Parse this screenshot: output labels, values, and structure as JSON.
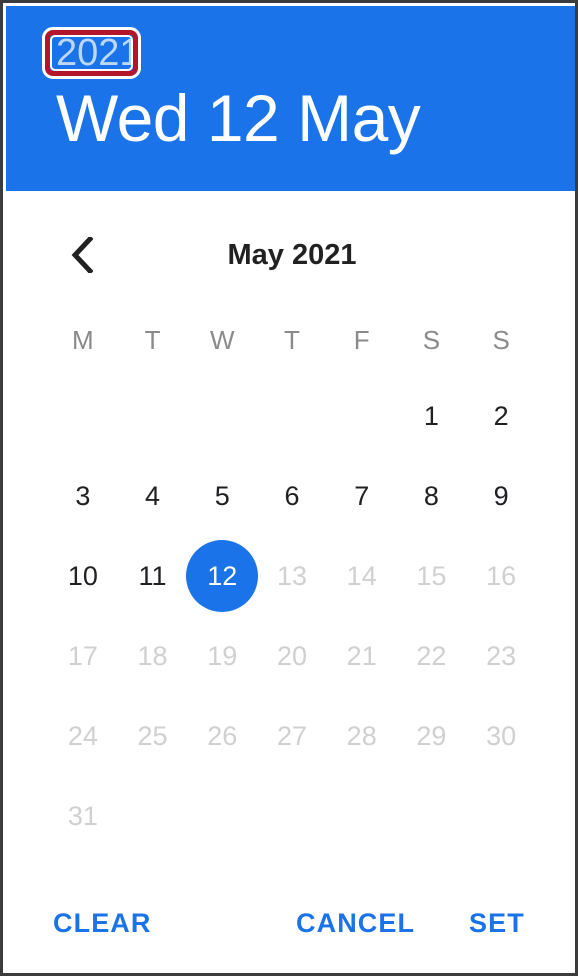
{
  "dialog": {
    "name": "material-date-picker",
    "header": {
      "year": "2021",
      "selected_date_label": "Wed 12 May",
      "background_color": "#1a73e8",
      "year_color": "#bcd7f7",
      "date_color": "#ffffff"
    },
    "annotation": {
      "target": "year",
      "shape": "rounded-rectangle",
      "color": "#b3162a"
    },
    "calendar": {
      "month_label": "May 2021",
      "prev_icon": "chevron-left-icon",
      "weekdays": [
        "M",
        "T",
        "W",
        "T",
        "F",
        "S",
        "S"
      ],
      "selected_day": "12",
      "selection_color": "#1a73e8",
      "disabled_color": "#d0d0d0",
      "weeks": [
        [
          {
            "label": "",
            "state": "empty"
          },
          {
            "label": "",
            "state": "empty"
          },
          {
            "label": "",
            "state": "empty"
          },
          {
            "label": "",
            "state": "empty"
          },
          {
            "label": "",
            "state": "empty"
          },
          {
            "label": "1",
            "state": "enabled"
          },
          {
            "label": "2",
            "state": "enabled"
          }
        ],
        [
          {
            "label": "3",
            "state": "enabled"
          },
          {
            "label": "4",
            "state": "enabled"
          },
          {
            "label": "5",
            "state": "enabled"
          },
          {
            "label": "6",
            "state": "enabled"
          },
          {
            "label": "7",
            "state": "enabled"
          },
          {
            "label": "8",
            "state": "enabled"
          },
          {
            "label": "9",
            "state": "enabled"
          }
        ],
        [
          {
            "label": "10",
            "state": "enabled"
          },
          {
            "label": "11",
            "state": "enabled"
          },
          {
            "label": "12",
            "state": "selected"
          },
          {
            "label": "13",
            "state": "disabled"
          },
          {
            "label": "14",
            "state": "disabled"
          },
          {
            "label": "15",
            "state": "disabled"
          },
          {
            "label": "16",
            "state": "disabled"
          }
        ],
        [
          {
            "label": "17",
            "state": "disabled"
          },
          {
            "label": "18",
            "state": "disabled"
          },
          {
            "label": "19",
            "state": "disabled"
          },
          {
            "label": "20",
            "state": "disabled"
          },
          {
            "label": "21",
            "state": "disabled"
          },
          {
            "label": "22",
            "state": "disabled"
          },
          {
            "label": "23",
            "state": "disabled"
          }
        ],
        [
          {
            "label": "24",
            "state": "disabled"
          },
          {
            "label": "25",
            "state": "disabled"
          },
          {
            "label": "26",
            "state": "disabled"
          },
          {
            "label": "27",
            "state": "disabled"
          },
          {
            "label": "28",
            "state": "disabled"
          },
          {
            "label": "29",
            "state": "disabled"
          },
          {
            "label": "30",
            "state": "disabled"
          }
        ],
        [
          {
            "label": "31",
            "state": "disabled"
          },
          {
            "label": "",
            "state": "empty"
          },
          {
            "label": "",
            "state": "empty"
          },
          {
            "label": "",
            "state": "empty"
          },
          {
            "label": "",
            "state": "empty"
          },
          {
            "label": "",
            "state": "empty"
          },
          {
            "label": "",
            "state": "empty"
          }
        ]
      ]
    },
    "actions": {
      "clear_label": "CLEAR",
      "cancel_label": "CANCEL",
      "set_label": "SET",
      "color": "#1a73e8"
    }
  }
}
